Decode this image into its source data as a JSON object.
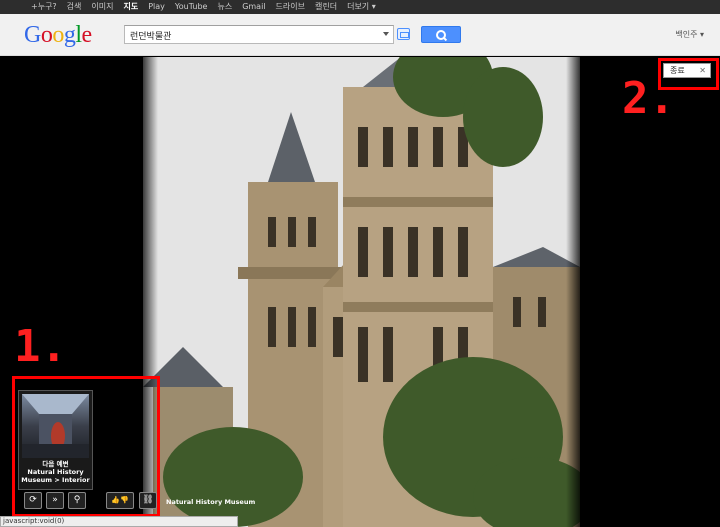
{
  "topbar": {
    "items": [
      "+누구?",
      "검색",
      "이미지",
      "지도",
      "Play",
      "YouTube",
      "뉴스",
      "Gmail",
      "드라이브",
      "캘린더",
      "더보기 ▾"
    ],
    "active_index": 3
  },
  "header": {
    "logo": "Google",
    "search_value": "런던박물관",
    "account": "백인주 ▾"
  },
  "viewer": {
    "thumbnail": {
      "title_line1": "다음 예변",
      "title_line2": "Natural History",
      "title_line3": "Museum > Interior"
    },
    "controls": [
      "⟳",
      "»",
      "⚲",
      "👍👎",
      "⛓"
    ],
    "caption": "Natural History Museum",
    "exit_label": "종료",
    "annotation_1": "1.",
    "annotation_2": "2."
  },
  "status": "javascript:void(0)",
  "colors": {
    "annotation": "#ff0000",
    "search_button": "#4d90fe",
    "topbar": "#2d2d2d"
  }
}
